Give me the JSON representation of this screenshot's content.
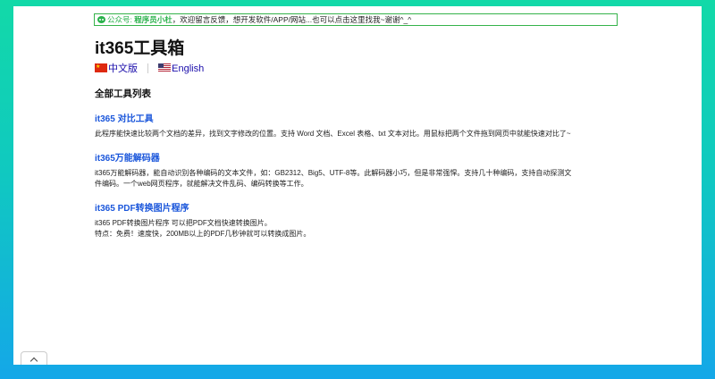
{
  "notice": {
    "label": "公众号:",
    "brand": "程序员小杜",
    "text": "，欢迎留言反馈，想开发软件/APP/网站...也可以点击这里找我~谢谢^_^"
  },
  "site": {
    "title": "it365工具箱"
  },
  "languages": [
    {
      "label": "中文版",
      "flag": "cn-flag-icon"
    },
    {
      "label": "English",
      "flag": "us-flag-icon"
    }
  ],
  "section": {
    "title": "全部工具列表"
  },
  "tools": [
    {
      "name": "it365 对比工具",
      "desc": [
        "此程序能快速比较两个文档的差异，找到文字修改的位置。支持 Word 文档、Excel 表格、txt 文本对比。用鼠标把两个文件拖到网页中就能快速对比了~"
      ]
    },
    {
      "name": "it365万能解码器",
      "desc": [
        "it365万能解码器，能自动识别各种编码的文本文件，如：GB2312、Big5、UTF-8等。此解码器小巧，但是非常强悍。支持几十种编码，支持自动探测文",
        "件编码。一个web网页程序，就能解决文件乱码、编码转换等工作。"
      ]
    },
    {
      "name": "it365 PDF转换图片程序",
      "desc": [
        "it365 PDF转换图片程序 可以把PDF文档快速转换图片。",
        "特点：免费！速度快，200MB以上的PDF几秒钟就可以转换成图片。"
      ]
    }
  ]
}
